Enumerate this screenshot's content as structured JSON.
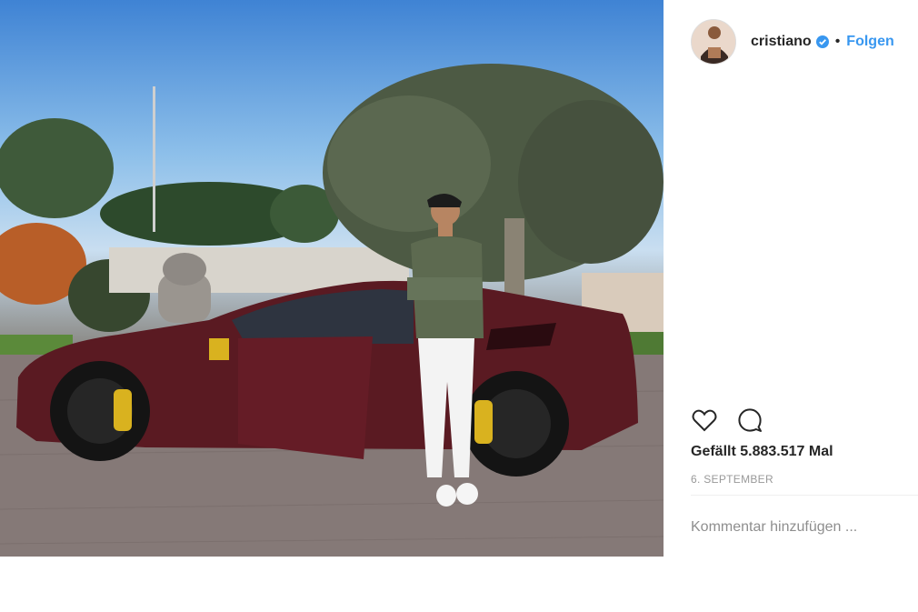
{
  "post": {
    "username": "cristiano",
    "dot": "•",
    "follow_label": "Folgen",
    "likes": "Gefällt 5.883.517 Mal",
    "date": "6. SEPTEMBER",
    "comment_placeholder": "Kommentar hinzufügen ..."
  },
  "icons": {
    "verified": "verified-badge-icon",
    "like": "heart-icon",
    "comment": "comment-bubble-icon"
  },
  "colors": {
    "link_blue": "#3897f0",
    "text": "#262626",
    "muted": "#999999",
    "car_body": "#5a1a22",
    "caliper": "#d9b21f"
  }
}
